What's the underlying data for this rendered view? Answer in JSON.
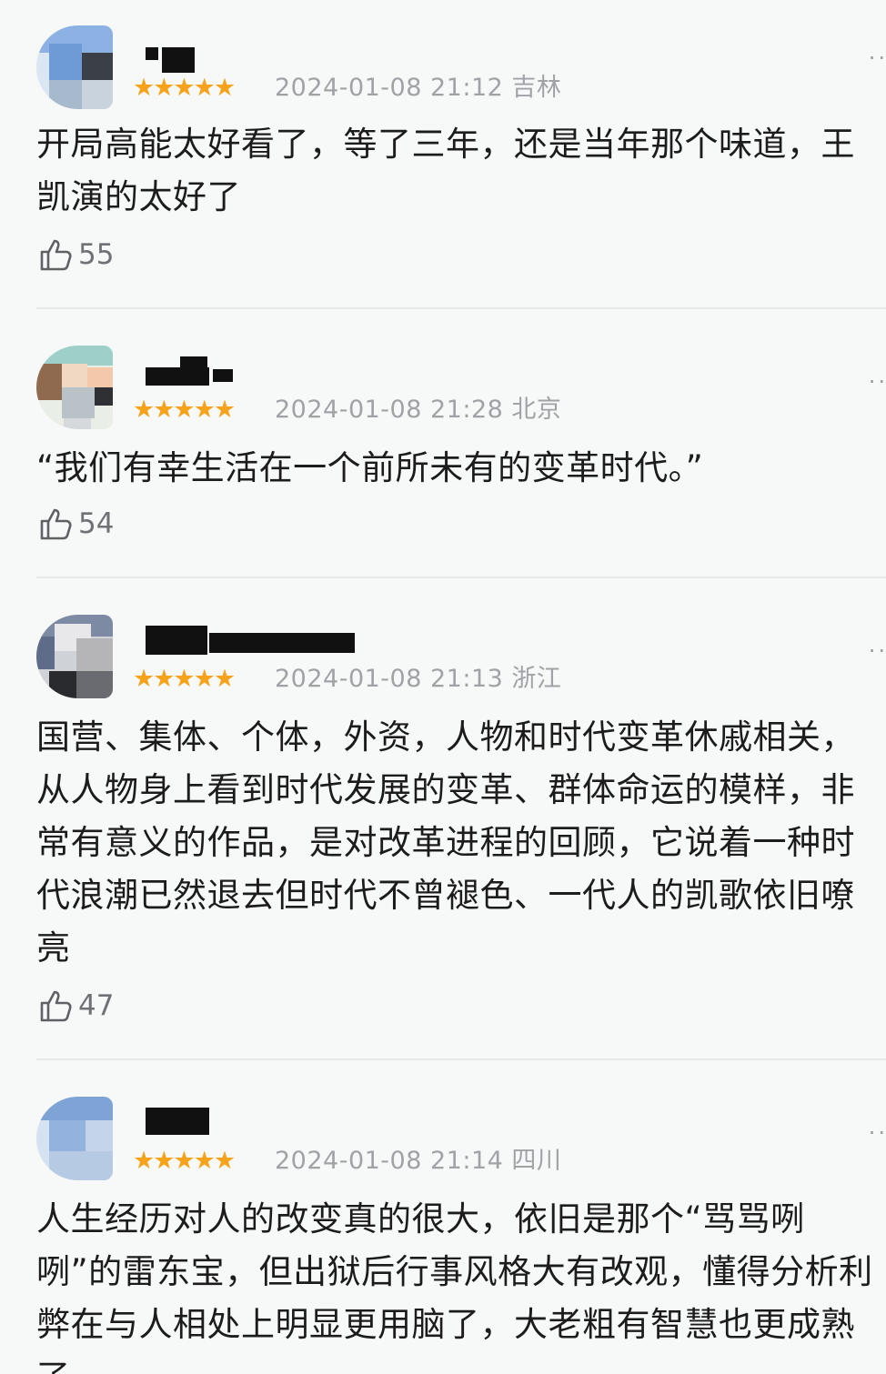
{
  "comments": [
    {
      "stars": "★★★★★",
      "meta": "2024-01-08 21:12 吉林",
      "more": "··",
      "text": "开局高能太好看了，等了三年，还是当年那个味道，王凯演的太好了",
      "likes": "55"
    },
    {
      "stars": "★★★★★",
      "meta": "2024-01-08 21:28 北京",
      "more": "··",
      "text": "“我们有幸生活在一个前所未有的变革时代。”",
      "likes": "54"
    },
    {
      "stars": "★★★★★",
      "meta": "2024-01-08 21:13 浙江",
      "more": "··",
      "text": "国营、集体、个体，外资，人物和时代变革休戚相关，从人物身上看到时代发展的变革、群体命运的模样，非常有意义的作品，是对改革进程的回顾，它说着一种时代浪潮已然退去但时代不曾褪色、一代人的凯歌依旧嘹亮",
      "likes": "47"
    },
    {
      "stars": "★★★★★",
      "meta": "2024-01-08 21:14 四川",
      "more": "··",
      "text": "人生经历对人的改变真的很大，依旧是那个“骂骂咧咧”的雷东宝，但出狱后行事风格大有改观，懂得分析利弊在与人相处上明显更用脑了，大老粗有智慧也更成熟了",
      "likes": ""
    }
  ]
}
